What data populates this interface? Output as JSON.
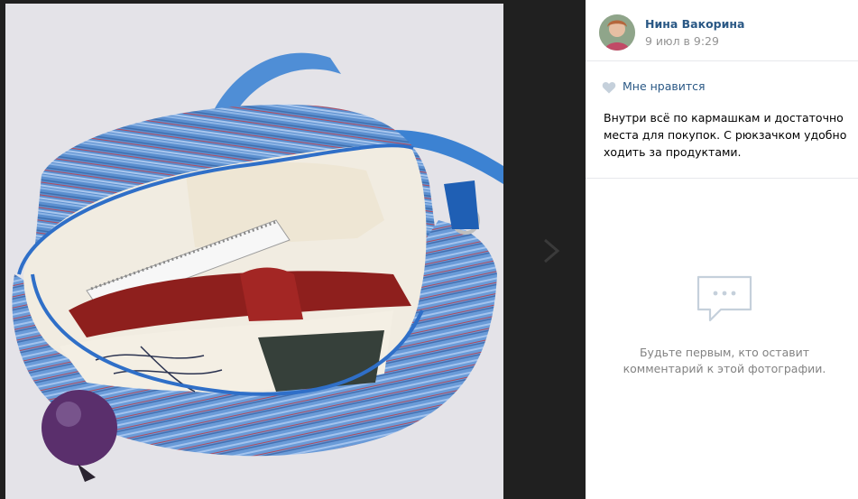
{
  "photo": {
    "description_icon": "photo",
    "next_icon": "chevron-right-icon"
  },
  "author": {
    "name": "Нина Вакорина",
    "date": "9 июл в 9:29"
  },
  "likes": {
    "label": "Мне нравится",
    "icon": "heart-icon"
  },
  "post": {
    "text": "Внутри всё по кармашкам и достаточно места для покупок. С рюкзачком удобно ходить за продуктами."
  },
  "comments": {
    "icon": "comments-icon",
    "empty_text": "Будьте первым, кто оставит комментарий к этой фотографии."
  },
  "colors": {
    "link": "#2a5885",
    "muted": "#939393",
    "empty": "#828282",
    "icon_stroke": "#c5d0db"
  }
}
